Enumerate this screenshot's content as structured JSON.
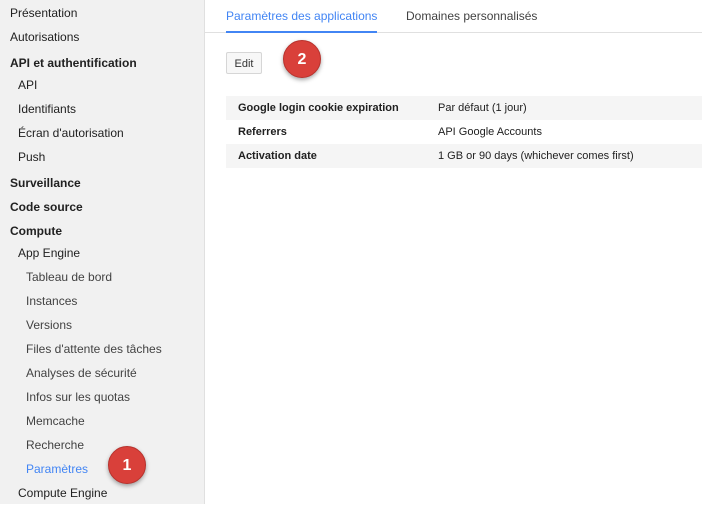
{
  "sidebar": {
    "items": [
      {
        "label": "Présentation",
        "level": 0,
        "bold": false
      },
      {
        "label": "Autorisations",
        "level": 0,
        "bold": false
      },
      {
        "label": "API et authentification",
        "level": 0,
        "bold": true
      },
      {
        "label": "API",
        "level": 1,
        "bold": false
      },
      {
        "label": "Identifiants",
        "level": 1,
        "bold": false
      },
      {
        "label": "Écran d'autorisation",
        "level": 1,
        "bold": false
      },
      {
        "label": "Push",
        "level": 1,
        "bold": false
      },
      {
        "label": "Surveillance",
        "level": 0,
        "bold": true
      },
      {
        "label": "Code source",
        "level": 0,
        "bold": true
      },
      {
        "label": "Compute",
        "level": 0,
        "bold": true
      },
      {
        "label": "App Engine",
        "level": 1,
        "bold": false
      },
      {
        "label": "Tableau de bord",
        "level": 2,
        "bold": false
      },
      {
        "label": "Instances",
        "level": 2,
        "bold": false
      },
      {
        "label": "Versions",
        "level": 2,
        "bold": false
      },
      {
        "label": "Files d'attente des tâches",
        "level": 2,
        "bold": false
      },
      {
        "label": "Analyses de sécurité",
        "level": 2,
        "bold": false
      },
      {
        "label": "Infos sur les quotas",
        "level": 2,
        "bold": false
      },
      {
        "label": "Memcache",
        "level": 2,
        "bold": false
      },
      {
        "label": "Recherche",
        "level": 2,
        "bold": false
      },
      {
        "label": "Paramètres",
        "level": 2,
        "bold": false,
        "active": true
      },
      {
        "label": "Compute Engine",
        "level": 1,
        "bold": false
      }
    ]
  },
  "tabs": [
    {
      "label": "Paramètres des applications",
      "active": true
    },
    {
      "label": "Domaines personnalisés",
      "active": false
    }
  ],
  "toolbar": {
    "edit_label": "Edit"
  },
  "settings": {
    "rows": [
      {
        "key": "Google login cookie expiration",
        "value": "Par défaut (1 jour)"
      },
      {
        "key": "Referrers",
        "value": "API Google Accounts"
      },
      {
        "key": "Activation date",
        "value": "1 GB or 90 days (whichever comes first)"
      }
    ]
  },
  "annotations": {
    "badge_1": "1",
    "badge_2": "2"
  },
  "colors": {
    "accent": "#4285f4",
    "badge": "#d9403a"
  }
}
